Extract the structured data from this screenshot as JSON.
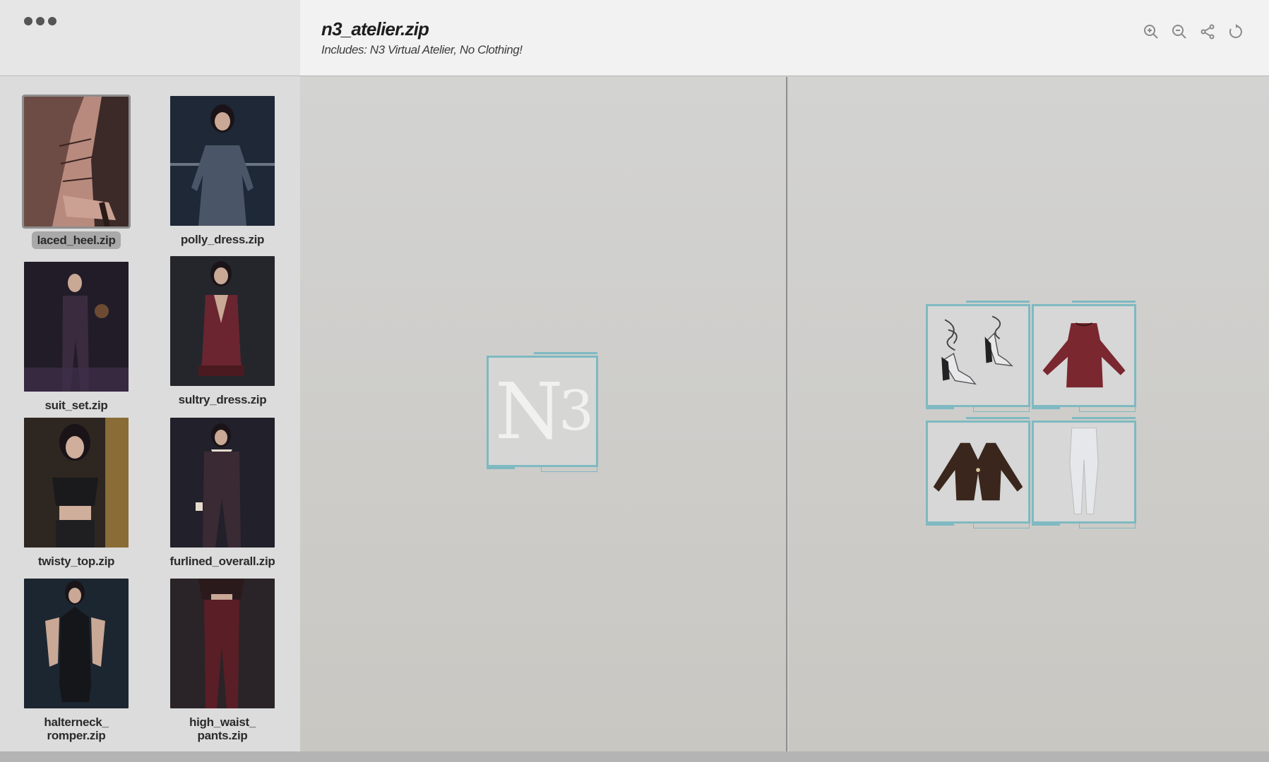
{
  "window": {
    "menu_icon": "ellipsis-icon"
  },
  "header": {
    "title": "n3_atelier.zip",
    "subtitle": "Includes: N3 Virtual Atelier, No Clothing!",
    "tools": [
      {
        "icon": "zoom-in-icon"
      },
      {
        "icon": "zoom-out-icon"
      },
      {
        "icon": "share-icon"
      },
      {
        "icon": "reset-icon"
      }
    ]
  },
  "files": [
    {
      "label": "laced_heel.zip",
      "selected": true,
      "color": "#6e5048"
    },
    {
      "label": "polly_dress.zip",
      "color": "#2a3546"
    },
    {
      "label": "suit_set.zip",
      "color": "#2a2230"
    },
    {
      "label": "sultry_dress.zip",
      "color": "#3a2a2e"
    },
    {
      "label": "twisty_top.zip",
      "color": "#3d3026"
    },
    {
      "label": "furlined_overall.zip",
      "color": "#2a2226"
    },
    {
      "label": "halterneck_\nromper.zip",
      "color": "#1f2830"
    },
    {
      "label": "high_waist_\npants.zip",
      "color": "#3a2328"
    }
  ],
  "preview": {
    "logo_text": "N",
    "logo_sub": "3",
    "accent": "#7fb9c1"
  },
  "contents": [
    {
      "icon": "heel-shoes-icon"
    },
    {
      "icon": "red-dress-icon"
    },
    {
      "icon": "jacket-icon"
    },
    {
      "icon": "white-pants-icon"
    }
  ]
}
